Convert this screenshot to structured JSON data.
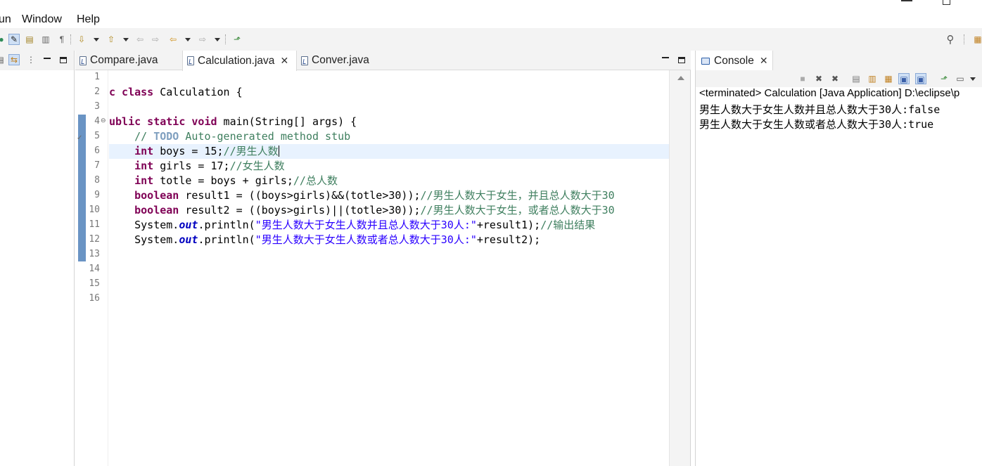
{
  "menubar": {
    "items": [
      "un",
      "Window",
      "Help"
    ]
  },
  "toolbar": {
    "icons": [
      "run-icon",
      "highlight-icon",
      "occurrences-icon",
      "block-selection-icon",
      "show-whitespace-icon",
      "next-annotation-icon",
      "previous-annotation-icon",
      "last-edit-icon",
      "back-icon",
      "forward-icon",
      "open-perspective-icon",
      "search-icon"
    ]
  },
  "editor": {
    "tabs": [
      {
        "label": "Compare.java",
        "active": false
      },
      {
        "label": "Calculation.java",
        "active": true
      },
      {
        "label": "Conver.java",
        "active": false
      }
    ],
    "line_numbers": [
      "1",
      "2",
      "3",
      "4",
      "5",
      "6",
      "7",
      "8",
      "9",
      "10",
      "11",
      "12",
      "13",
      "14",
      "15",
      "16"
    ],
    "current_line": 6,
    "code": {
      "l2_kw1": "c class",
      "l2_name": " Calculation {",
      "l4_kw": "ublic static void",
      "l4_rest": " main(String[] args) {",
      "l5_pre": "    // ",
      "l5_todo": "TODO",
      "l5_rest": " Auto-generated method stub",
      "l6_kw": "int",
      "l6_code": " boys = 15;",
      "l6_cm": "//男生人数",
      "l7_kw": "int",
      "l7_code": " girls = 17;",
      "l7_cm": "//女生人数",
      "l8_kw": "int",
      "l8_code": " totle = boys + girls;",
      "l8_cm": "//总人数",
      "l9_kw": "boolean",
      "l9_code": " result1 = ((boys>girls)&&(totle>30));",
      "l9_cm": "//男生人数大于女生，并且总人数大于30",
      "l10_kw": "boolean",
      "l10_code": " result2 = ((boys>girls)||(totle>30));",
      "l10_cm": "//男生人数大于女生，或者总人数大于30",
      "l11_a": "System.",
      "l11_field": "out",
      "l11_b": ".println(",
      "l11_str": "\"男生人数大于女生人数并且总人数大于30人:\"",
      "l11_c": "+result1);",
      "l11_cm": "//输出结果",
      "l12_a": "System.",
      "l12_field": "out",
      "l12_b": ".println(",
      "l12_str": "\"男生人数大于女生人数或者总人数大于30人:\"",
      "l12_c": "+result2);"
    }
  },
  "console": {
    "tab_label": "Console",
    "header": "<terminated> Calculation [Java Application] D:\\eclipse\\p",
    "output": [
      "男生人数大于女生人数并且总人数大于30人:false",
      "男生人数大于女生人数或者总人数大于30人:true"
    ]
  },
  "colors": {
    "keyword": "#7f0055",
    "comment": "#3f7f5f",
    "string": "#2a00ff",
    "field": "#0000c0",
    "current_line": "#e8f2fe",
    "change_bar": "#6a94c4"
  }
}
